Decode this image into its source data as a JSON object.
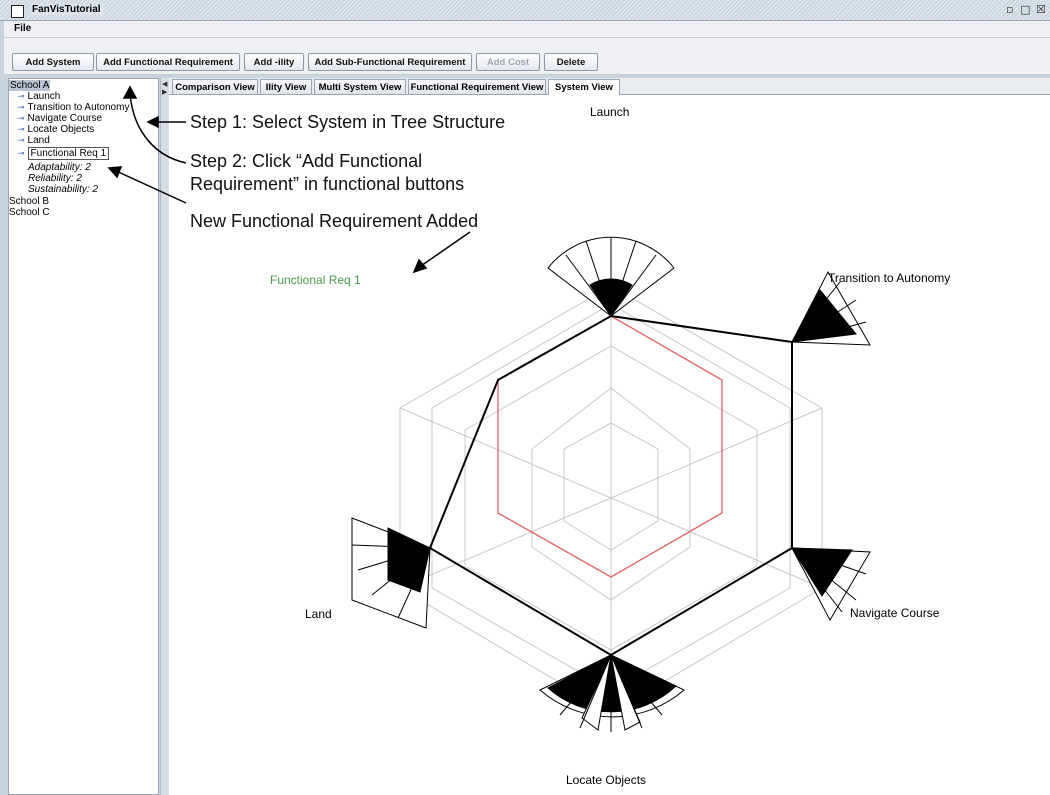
{
  "window": {
    "title": "FanVisTutorial",
    "controls": [
      "restore-icon",
      "maximize-icon",
      "close-icon"
    ]
  },
  "menu": {
    "file": "File"
  },
  "toolbar": {
    "add_system": "Add System",
    "add_functional_requirement": "Add Functional Requirement",
    "add_ility": "Add -ility",
    "add_sub_functional_requirement": "Add Sub-Functional Requirement",
    "add_cost": "Add Cost",
    "delete": "Delete"
  },
  "tree": {
    "school_a": "School A",
    "items": [
      "Launch",
      "Transition to Autonomy",
      "Navigate Course",
      "Locate Objects",
      "Land",
      "Functional Req 1"
    ],
    "ilities": [
      "Adaptability: 2",
      "Reliability: 2",
      "Sustainability: 2"
    ],
    "school_b": "School B",
    "school_c": "School C"
  },
  "tabs": [
    "Comparison View",
    "Ility View",
    "Multi System View",
    "Functional Requirement View",
    "System View"
  ],
  "active_tab": "System View",
  "annotations": {
    "step1": "Step 1: Select System in Tree Structure",
    "step2_line1": "Step 2: Click “Add Functional",
    "step2_line2": "Requirement” in functional buttons",
    "step3": "New Functional Requirement Added"
  },
  "chart_labels": {
    "launch": "Launch",
    "transition": "Transition to Autonomy",
    "navigate": "Navigate Course",
    "locate": "Locate Objects",
    "land": "Land",
    "new_req": "Functional Req 1"
  },
  "colors": {
    "new_req_label": "#4a9a4a",
    "mid_ring": "#e06060",
    "grid": "#c8c8c8"
  }
}
